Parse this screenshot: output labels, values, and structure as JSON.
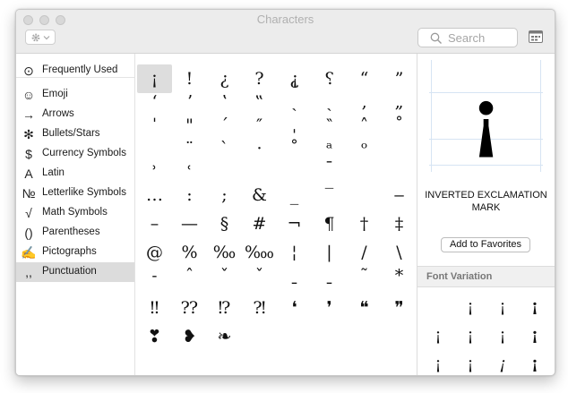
{
  "window": {
    "title": "Characters"
  },
  "toolbar": {
    "action_icon": "gear-icon",
    "search_placeholder": "Search",
    "view_toggle_icon": "grid-view-icon"
  },
  "sidebar": {
    "items": [
      {
        "icon_glyph": "⊙",
        "icon": "clock-icon",
        "label": "Frequently Used"
      },
      {
        "icon_glyph": "☺",
        "icon": "emoji-face-icon",
        "label": "Emoji"
      },
      {
        "icon_glyph": "→",
        "icon": "arrow-icon",
        "label": "Arrows"
      },
      {
        "icon_glyph": "✻",
        "icon": "asterisk-star-icon",
        "label": "Bullets/Stars"
      },
      {
        "icon_glyph": "$",
        "icon": "dollar-icon",
        "label": "Currency Symbols"
      },
      {
        "icon_glyph": "A",
        "icon": "latin-a-icon",
        "label": "Latin"
      },
      {
        "icon_glyph": "№",
        "icon": "numero-sign-icon",
        "label": "Letterlike Symbols"
      },
      {
        "icon_glyph": "√",
        "icon": "square-root-icon",
        "label": "Math Symbols"
      },
      {
        "icon_glyph": "()",
        "icon": "parentheses-icon",
        "label": "Parentheses"
      },
      {
        "icon_glyph": "✍",
        "icon": "pictograph-hand-icon",
        "label": "Pictographs"
      },
      {
        "icon_glyph": ",,",
        "icon": "punctuation-icon",
        "label": "Punctuation"
      }
    ],
    "selected_index": 10
  },
  "characters": [
    [
      "¡",
      "!",
      "¿",
      "?",
      "⸘",
      "⸮",
      "“",
      "”"
    ],
    [
      "ʻ",
      "ʼ",
      "ʽ",
      "‟",
      "ˏ",
      "ˎ",
      "‚",
      "„"
    ],
    [
      "ˈ",
      "\"",
      "ˊ",
      "″",
      "ˌ",
      "‶",
      "˄",
      "˚"
    ],
    [
      "",
      "¨",
      "ˋ",
      "·",
      "˚",
      "ᵃ",
      "ᵒ",
      ""
    ],
    [
      "˒",
      "˓",
      "",
      "",
      "",
      "ˉ",
      "",
      ""
    ],
    [
      "…",
      ":",
      ";",
      "&",
      "_",
      "‾",
      "",
      "‒"
    ],
    [
      "–",
      "—",
      "§",
      "#",
      "¬",
      "¶",
      "†",
      "‡"
    ],
    [
      "@",
      "%",
      "‰",
      "‱",
      "¦",
      "|",
      "/",
      "\\"
    ],
    [
      "˗",
      "ˆ",
      "ˇ",
      "ˇ",
      "ˍ",
      "ˍ",
      "˜",
      "*"
    ],
    [
      "‼",
      "⁇",
      "⁉",
      "⁈",
      "❛",
      "❜",
      "❝",
      "❞"
    ],
    [
      "❣",
      "❥",
      "❧",
      "",
      "",
      "",
      "",
      ""
    ]
  ],
  "selected_char": {
    "glyph": "¡",
    "name": "INVERTED EXCLAMATION MARK",
    "add_button": "Add to Favorites"
  },
  "font_variation": {
    "title": "Font Variation",
    "glyphs": [
      [
        "",
        "¡",
        "¡",
        "¡"
      ],
      [
        "¡",
        "¡",
        "¡",
        "¡"
      ],
      [
        "¡",
        "¡",
        "¡",
        "¡"
      ]
    ]
  }
}
